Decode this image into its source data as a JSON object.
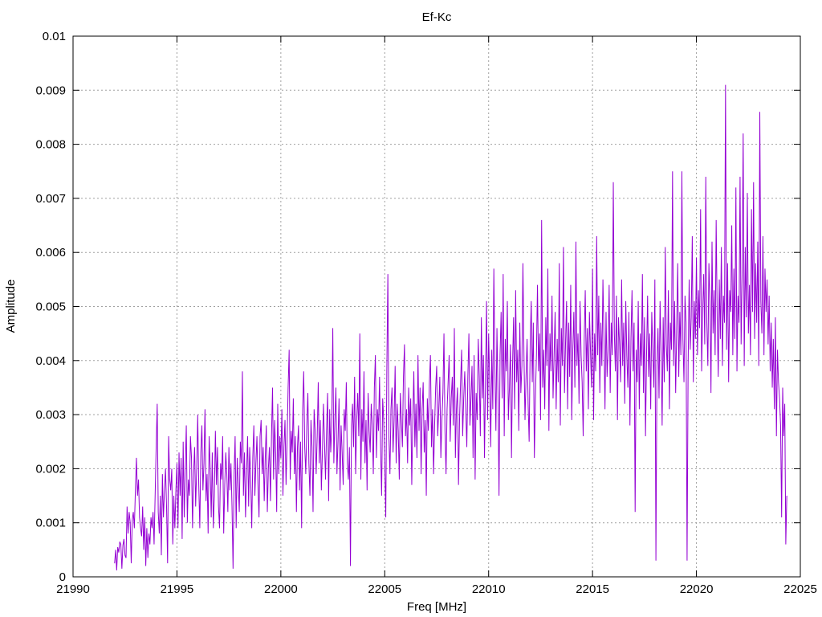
{
  "chart_data": {
    "type": "line",
    "title": "Ef-Kc",
    "xlabel": "Freq [MHz]",
    "ylabel": "Amplitude",
    "xlim": [
      21990,
      22025
    ],
    "ylim": [
      0,
      0.01
    ],
    "xticks": [
      21990,
      21995,
      22000,
      22005,
      22010,
      22015,
      22020,
      22025
    ],
    "xtick_labels": [
      "21990",
      "21995",
      "22000",
      "22005",
      "22010",
      "22015",
      "22020",
      "22025"
    ],
    "yticks": [
      0,
      0.001,
      0.002,
      0.003,
      0.004,
      0.005,
      0.006,
      0.007,
      0.008,
      0.009,
      0.01
    ],
    "ytick_labels": [
      "0",
      "0.001",
      "0.002",
      "0.003",
      "0.004",
      "0.005",
      "0.006",
      "0.007",
      "0.008",
      "0.009",
      "0.01"
    ],
    "grid": true,
    "legend": false,
    "series": [
      {
        "color": "#9400d3",
        "x_start": 21992.0,
        "x_step": 0.05,
        "values": [
          0.00025,
          0.0005,
          0.00012,
          0.00055,
          0.00045,
          0.00065,
          0.0006,
          0.00015,
          0.00058,
          0.0007,
          0.0004,
          0.00035,
          0.0013,
          0.0008,
          0.0012,
          0.001,
          0.00025,
          0.00105,
          0.0012,
          0.0009,
          0.0016,
          0.0022,
          0.0015,
          0.0018,
          0.0011,
          0.0009,
          0.00075,
          0.0013,
          0.0005,
          0.0011,
          0.0002,
          0.0009,
          0.00035,
          0.0008,
          0.0006,
          0.0011,
          0.0009,
          0.0012,
          0.0006,
          0.0015,
          0.0024,
          0.0032,
          0.0012,
          0.0008,
          0.0015,
          0.0004,
          0.0019,
          0.0011,
          0.0016,
          0.002,
          0.0013,
          0.00025,
          0.0026,
          0.0018,
          0.0016,
          0.002,
          0.0006,
          0.0015,
          0.0009,
          0.0016,
          0.0021,
          0.0009,
          0.0023,
          0.0015,
          0.0022,
          0.0007,
          0.0025,
          0.0011,
          0.002,
          0.0028,
          0.001,
          0.0018,
          0.0015,
          0.0026,
          0.0022,
          0.0009,
          0.0019,
          0.0024,
          0.0013,
          0.002,
          0.003,
          0.0017,
          0.0009,
          0.0023,
          0.0028,
          0.0016,
          0.0021,
          0.0031,
          0.0014,
          0.0019,
          0.0008,
          0.0026,
          0.002,
          0.0011,
          0.0023,
          0.0009,
          0.0015,
          0.0027,
          0.0017,
          0.0024,
          0.0013,
          0.0009,
          0.0021,
          0.0018,
          0.0026,
          0.0008,
          0.0017,
          0.0023,
          0.0019,
          0.0012,
          0.0024,
          0.0016,
          0.0021,
          0.0013,
          0.00015,
          0.0019,
          0.0026,
          0.0009,
          0.0022,
          0.0017,
          0.0012,
          0.0025,
          0.0021,
          0.0038,
          0.0015,
          0.0023,
          0.0011,
          0.0019,
          0.0026,
          0.0013,
          0.0024,
          0.0018,
          0.0009,
          0.0022,
          0.0028,
          0.0015,
          0.0021,
          0.0026,
          0.0017,
          0.0011,
          0.0026,
          0.0029,
          0.0019,
          0.0024,
          0.0014,
          0.0022,
          0.0028,
          0.0012,
          0.002,
          0.0024,
          0.0014,
          0.0026,
          0.0035,
          0.0018,
          0.0029,
          0.0023,
          0.0012,
          0.0032,
          0.0019,
          0.0026,
          0.0022,
          0.0031,
          0.0015,
          0.0024,
          0.0029,
          0.0017,
          0.0025,
          0.0035,
          0.0042,
          0.0018,
          0.0027,
          0.0023,
          0.0033,
          0.0019,
          0.0026,
          0.0012,
          0.0024,
          0.0028,
          0.0016,
          0.0025,
          0.0009,
          0.0031,
          0.0038,
          0.0024,
          0.0019,
          0.0028,
          0.0034,
          0.0021,
          0.0015,
          0.0029,
          0.0024,
          0.0012,
          0.0031,
          0.0027,
          0.0019,
          0.0026,
          0.0036,
          0.0021,
          0.0029,
          0.0016,
          0.0023,
          0.0032,
          0.0025,
          0.0018,
          0.0027,
          0.0034,
          0.0014,
          0.0031,
          0.0023,
          0.0028,
          0.0046,
          0.0021,
          0.0029,
          0.0035,
          0.0019,
          0.0025,
          0.0033,
          0.0016,
          0.0028,
          0.0023,
          0.0017,
          0.0031,
          0.0027,
          0.0036,
          0.0021,
          0.0018,
          0.0024,
          0.0002,
          0.0028,
          0.0032,
          0.0024,
          0.0037,
          0.0019,
          0.0029,
          0.0034,
          0.0026,
          0.0045,
          0.0018,
          0.0031,
          0.0025,
          0.0038,
          0.0021,
          0.0029,
          0.0016,
          0.0034,
          0.0027,
          0.0023,
          0.0032,
          0.0028,
          0.0019,
          0.0035,
          0.0041,
          0.0022,
          0.0031,
          0.0027,
          0.0037,
          0.0024,
          0.0015,
          0.0033,
          0.0029,
          0.0021,
          0.0011,
          0.0038,
          0.0056,
          0.0026,
          0.0019,
          0.0031,
          0.0035,
          0.0023,
          0.0029,
          0.0039,
          0.0021,
          0.0032,
          0.0027,
          0.0018,
          0.0034,
          0.0029,
          0.0024,
          0.0037,
          0.0043,
          0.0026,
          0.0031,
          0.0021,
          0.0035,
          0.0028,
          0.0033,
          0.0017,
          0.0029,
          0.0038,
          0.0024,
          0.0032,
          0.0022,
          0.0041,
          0.0027,
          0.0035,
          0.0019,
          0.0031,
          0.0036,
          0.0023,
          0.0029,
          0.0015,
          0.0033,
          0.0027,
          0.0036,
          0.0041,
          0.0024,
          0.0031,
          0.0019,
          0.0028,
          0.0035,
          0.0039,
          0.0026,
          0.0031,
          0.0037,
          0.0022,
          0.0029,
          0.0034,
          0.0045,
          0.0027,
          0.0019,
          0.0031,
          0.0036,
          0.0041,
          0.0025,
          0.0033,
          0.0037,
          0.0028,
          0.0046,
          0.0022,
          0.0031,
          0.0035,
          0.0017,
          0.0029,
          0.0036,
          0.0042,
          0.0026,
          0.0033,
          0.0038,
          0.0031,
          0.0024,
          0.0037,
          0.0045,
          0.0028,
          0.0033,
          0.0039,
          0.0022,
          0.0041,
          0.0018,
          0.0034,
          0.0029,
          0.0044,
          0.0037,
          0.0026,
          0.0048,
          0.0033,
          0.0041,
          0.0022,
          0.0037,
          0.0051,
          0.0029,
          0.0045,
          0.0036,
          0.0024,
          0.0042,
          0.0031,
          0.0057,
          0.0039,
          0.0027,
          0.0046,
          0.0034,
          0.0015,
          0.0041,
          0.0049,
          0.0033,
          0.0056,
          0.0026,
          0.0044,
          0.0038,
          0.0051,
          0.0029,
          0.0035,
          0.0043,
          0.0022,
          0.0039,
          0.0048,
          0.0031,
          0.0053,
          0.0036,
          0.0042,
          0.0027,
          0.0047,
          0.0034,
          0.0039,
          0.0058,
          0.0041,
          0.0029,
          0.0037,
          0.0044,
          0.0032,
          0.0025,
          0.0043,
          0.0051,
          0.0036,
          0.0047,
          0.0022,
          0.0033,
          0.0041,
          0.0054,
          0.0038,
          0.0045,
          0.0029,
          0.0066,
          0.0035,
          0.0042,
          0.0031,
          0.0048,
          0.0039,
          0.0057,
          0.0027,
          0.0045,
          0.0038,
          0.0052,
          0.0033,
          0.0041,
          0.0049,
          0.0031,
          0.0044,
          0.0036,
          0.0058,
          0.0028,
          0.0046,
          0.0039,
          0.0061,
          0.0034,
          0.0043,
          0.0051,
          0.0031,
          0.0047,
          0.0037,
          0.0054,
          0.0029,
          0.0042,
          0.0049,
          0.0035,
          0.0062,
          0.0039,
          0.0045,
          0.0032,
          0.0051,
          0.0041,
          0.0036,
          0.0026,
          0.0044,
          0.0053,
          0.0038,
          0.0046,
          0.0031,
          0.0049,
          0.0042,
          0.0035,
          0.0057,
          0.0029,
          0.0045,
          0.0038,
          0.0063,
          0.0041,
          0.0052,
          0.0034,
          0.0047,
          0.0039,
          0.0055,
          0.0044,
          0.0031,
          0.0049,
          0.0037,
          0.0042,
          0.0054,
          0.0034,
          0.0047,
          0.0041,
          0.0073,
          0.0045,
          0.0038,
          0.0052,
          0.0029,
          0.0048,
          0.0043,
          0.0036,
          0.0055,
          0.0039,
          0.0047,
          0.0032,
          0.0051,
          0.0041,
          0.0035,
          0.0049,
          0.0028,
          0.0044,
          0.0053,
          0.0038,
          0.0047,
          0.0012,
          0.0042,
          0.0036,
          0.0051,
          0.0031,
          0.0045,
          0.0039,
          0.0056,
          0.0034,
          0.0048,
          0.0026,
          0.0041,
          0.0052,
          0.0037,
          0.0045,
          0.0031,
          0.0049,
          0.0042,
          0.0035,
          0.0055,
          0.0003,
          0.0039,
          0.0046,
          0.0033,
          0.0051,
          0.0041,
          0.0028,
          0.0048,
          0.0036,
          0.0061,
          0.0043,
          0.0038,
          0.0053,
          0.0031,
          0.0047,
          0.0042,
          0.0075,
          0.0039,
          0.0051,
          0.0034,
          0.0046,
          0.0058,
          0.0037,
          0.0049,
          0.0041,
          0.0075,
          0.0044,
          0.0036,
          0.0052,
          0.0047,
          0.0003,
          0.0039,
          0.0055,
          0.0042,
          0.0048,
          0.0063,
          0.0036,
          0.0051,
          0.0044,
          0.0059,
          0.0041,
          0.0053,
          0.0046,
          0.0068,
          0.0038,
          0.0049,
          0.0056,
          0.0043,
          0.0074,
          0.0047,
          0.0039,
          0.0058,
          0.0051,
          0.0034,
          0.0062,
          0.0045,
          0.0053,
          0.0041,
          0.0066,
          0.0048,
          0.0037,
          0.0055,
          0.0044,
          0.0061,
          0.0039,
          0.0052,
          0.0047,
          0.0091,
          0.0042,
          0.0058,
          0.0036,
          0.0053,
          0.0049,
          0.0065,
          0.0041,
          0.0057,
          0.0044,
          0.0072,
          0.0038,
          0.0052,
          0.0047,
          0.0074,
          0.0043,
          0.0056,
          0.0082,
          0.0039,
          0.0061,
          0.0048,
          0.0071,
          0.0045,
          0.0054,
          0.0041,
          0.0068,
          0.0049,
          0.0073,
          0.0044,
          0.0058,
          0.0047,
          0.0062,
          0.0039,
          0.0086,
          0.0051,
          0.0045,
          0.0063,
          0.0041,
          0.0057,
          0.0049,
          0.0055,
          0.0043,
          0.0052,
          0.0038,
          0.0047,
          0.0035,
          0.0044,
          0.0031,
          0.0048,
          0.0026,
          0.0042,
          0.0036,
          0.0033,
          0.0028,
          0.0011,
          0.0035,
          0.0026,
          0.0032,
          0.0006,
          0.0015
        ]
      }
    ]
  }
}
